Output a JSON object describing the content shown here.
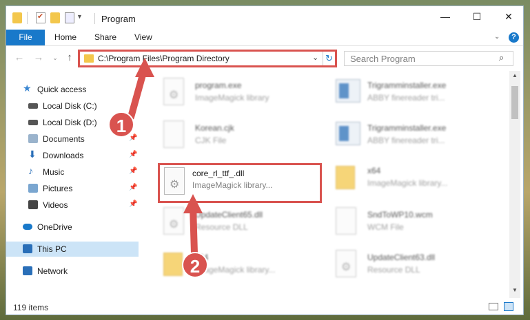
{
  "window": {
    "title": "Program",
    "controls": {
      "minimize": "—",
      "maximize": "☐",
      "close": "✕"
    }
  },
  "ribbon": {
    "tabs": [
      "File",
      "Home",
      "Share",
      "View"
    ]
  },
  "navigation": {
    "address": "C:\\Program Files\\Program Directory",
    "search_placeholder": "Search Program"
  },
  "sidebar": {
    "items": [
      {
        "label": "Quick access",
        "icon": "star-icon",
        "color": "#3a86d1"
      },
      {
        "label": "Local Disk (C:)",
        "icon": "drive-icon",
        "color": "#555555"
      },
      {
        "label": "Local Disk (D:)",
        "icon": "drive-icon",
        "color": "#555555"
      },
      {
        "label": "Documents",
        "icon": "documents-icon",
        "color": "#9ab3cc"
      },
      {
        "label": "Downloads",
        "icon": "downloads-icon",
        "color": "#2a6fb8"
      },
      {
        "label": "Music",
        "icon": "music-icon",
        "color": "#2a6fb8"
      },
      {
        "label": "Pictures",
        "icon": "pictures-icon",
        "color": "#7aa6d0"
      },
      {
        "label": "Videos",
        "icon": "videos-icon",
        "color": "#444444"
      },
      {
        "label": "OneDrive",
        "icon": "cloud-icon",
        "color": "#1979ca"
      },
      {
        "label": "This PC",
        "icon": "computer-icon",
        "color": "#2a6fb8"
      },
      {
        "label": "Network",
        "icon": "network-icon",
        "color": "#2a6fb8"
      }
    ]
  },
  "files": [
    {
      "name": "program.exe",
      "desc": "ImageMagick library",
      "icon": "exe-icon"
    },
    {
      "name": "Trigramminstaller.exe",
      "desc": "ABBY finereader tri...",
      "icon": "installer-icon"
    },
    {
      "name": "Korean.cjk",
      "desc": "CJK File",
      "icon": "file-icon"
    },
    {
      "name": "Trigramminstaller.exe",
      "desc": "ABBY finereader tri...",
      "icon": "installer-icon"
    },
    {
      "name": "core_rl_ttf_.dll",
      "desc": "ImageMagick library...",
      "icon": "dll-icon"
    },
    {
      "name": "x64",
      "desc": "ImageMagick library...",
      "icon": "folder-icon"
    },
    {
      "name": "UpdateClient65.dll",
      "desc": "Resource DLL",
      "icon": "dll-icon"
    },
    {
      "name": "SndToWP10.wcm",
      "desc": "WCM File",
      "icon": "file-icon"
    },
    {
      "name": "x64",
      "desc": "ImageMagick library...",
      "icon": "folder-icon"
    },
    {
      "name": "UpdateClient63.dll",
      "desc": "Resource DLL",
      "icon": "dll-icon"
    }
  ],
  "status": {
    "items_count": "119 items"
  },
  "annotations": {
    "step1": "1",
    "step2": "2",
    "color": "#d9534f"
  }
}
